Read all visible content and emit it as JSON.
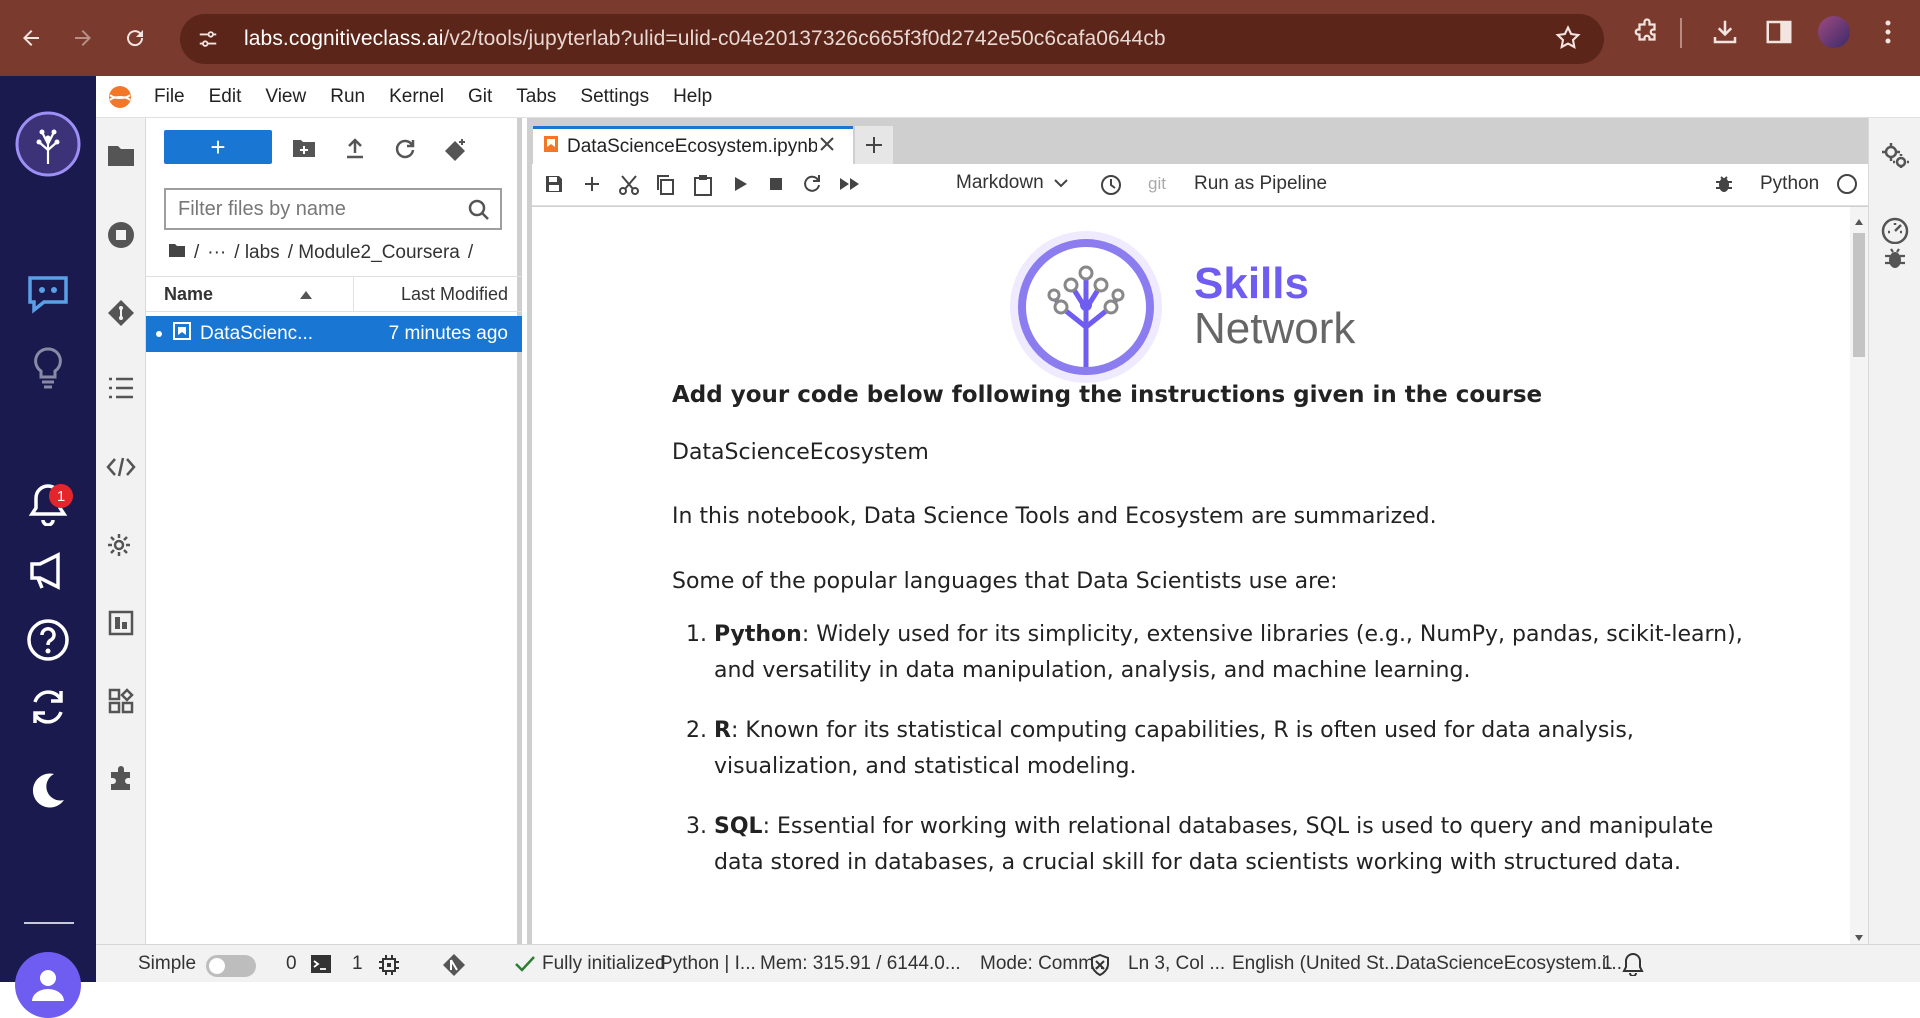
{
  "browser": {
    "url_host": "labs.cognitiveclass.ai",
    "url_path": "/v2/tools/jupyterlab?ulid=ulid-c04e20137326c665f3f0d2742e50c6cafa0644cb"
  },
  "rail": {
    "notification_count": "1"
  },
  "menu": {
    "items": [
      "File",
      "Edit",
      "View",
      "Run",
      "Kernel",
      "Git",
      "Tabs",
      "Settings",
      "Help"
    ]
  },
  "filebrowser": {
    "new_label": "+",
    "filter_placeholder": "Filter files by name",
    "breadcrumbs": [
      "/",
      "···",
      "/ labs",
      "/ Module2_Coursera",
      "/"
    ],
    "col_name": "Name",
    "col_modified": "Last Modified",
    "files": [
      {
        "name": "DataScienc...",
        "modified": "7 minutes ago"
      }
    ]
  },
  "notebook": {
    "tab_label": "DataScienceEcosystem.ipynb",
    "cell_type": "Markdown",
    "git_label": "git",
    "run_pipeline": "Run as Pipeline",
    "kernel": "Python",
    "logo_line1": "Skills",
    "logo_line2": "Network",
    "heading": "Add your code below following the instructions given in the course",
    "title": "DataScienceEcosystem",
    "intro": "In this notebook, Data Science Tools and Ecosystem are summarized.",
    "languages_intro": "Some of the popular languages that Data Scientists use are:",
    "languages": [
      {
        "name": "Python",
        "desc": ": Widely used for its simplicity, extensive libraries (e.g., NumPy, pandas, scikit-learn), and versatility in data manipulation, analysis, and machine learning."
      },
      {
        "name": "R",
        "desc": ": Known for its statistical computing capabilities, R is often used for data analysis, visualization, and statistical modeling."
      },
      {
        "name": "SQL",
        "desc": ": Essential for working with relational databases, SQL is used to query and manipulate data stored in databases, a crucial skill for data scientists working with structured data."
      }
    ]
  },
  "statusbar": {
    "simple": "Simple",
    "terminals": "0",
    "kernels": "1",
    "git_status": "Fully initialized",
    "kernel_status": "Python | I...",
    "memory": "Mem: 315.91 / 6144.0...",
    "mode": "Mode: Comm...",
    "cursor": "Ln 3, Col ...",
    "language": "English (United St...",
    "file": "DataScienceEcosystem.i...",
    "notifications": "1"
  },
  "colors": {
    "browser_frame": "#7a3b2e",
    "rail_bg": "#1a1a4e",
    "accent_blue": "#1976d2",
    "brand_purple": "#6f5cf0"
  }
}
